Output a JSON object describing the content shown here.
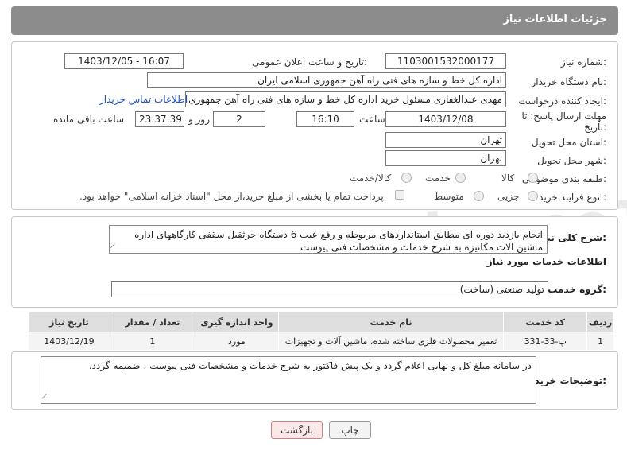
{
  "header": {
    "title": "جزئیات اطلاعات نیاز"
  },
  "form": {
    "need_number_label": "شماره نیاز:",
    "need_number": "1103001532000177",
    "announce_label": "تاریخ و ساعت اعلان عمومی:",
    "announce_value": "1403/12/05 - 16:07",
    "buyer_org_label": "نام دستگاه خریدار:",
    "buyer_org": "اداره کل خط و سازه های فنی راه آهن جمهوری اسلامی ایران",
    "creator_label": "ایجاد کننده درخواست:",
    "creator": "مهدی عبدالغفاری مسئول خرید اداره کل خط و سازه های فنی راه آهن جمهوری",
    "contact_link": "اطلاعات تماس خریدار",
    "deadline_label_1": "مهلت ارسال پاسخ: تا",
    "deadline_label_2": "تاریخ:",
    "deadline_date": "1403/12/08",
    "time_label": "ساعت",
    "deadline_time": "16:10",
    "days_value": "2",
    "days_label": "روز و",
    "remaining_value": "23:37:39",
    "remaining_label": "ساعت باقی مانده",
    "province_label": "استان محل تحویل:",
    "province": "تهران",
    "city_label": "شهر محل تحویل:",
    "city": "تهران",
    "category_label": "طبقه بندی موضوعی:",
    "category_options": [
      "کالا",
      "خدمت",
      "کالا/خدمت"
    ],
    "process_label": "نوع فرآیند خرید :",
    "process_options": [
      "جزیی",
      "متوسط"
    ],
    "payment_note": "پرداخت تمام یا بخشی از مبلغ خرید،از محل \"اسناد خزانه اسلامی\" خواهد بود."
  },
  "description": {
    "label": "شرح کلی نیاز:",
    "text": "انجام بازدید دوره ای مطابق استانداردهای مربوطه و رفع عیب 6 دستگاه جرثقیل سقفی کارگاههای اداره ماشین آلات مکانیزه به شرح خدمات و مشخصات فنی پیوست"
  },
  "services": {
    "section_title": "اطلاعات خدمات مورد نیاز",
    "group_label": "گروه خدمت:",
    "group_value": "تولید صنعتی (ساخت)",
    "columns": [
      "ردیف",
      "کد خدمت",
      "نام خدمت",
      "واحد اندازه گیری",
      "تعداد / مقدار",
      "تاریخ نیاز"
    ],
    "rows": [
      [
        "1",
        "پ-33-331",
        "تعمیر محصولات فلزی ساخته شده، ماشین آلات و تجهیزات",
        "مورد",
        "1",
        "1403/12/19"
      ]
    ]
  },
  "buyer_notes": {
    "label": "توضیحات خریدار:",
    "text": "در سامانه مبلغ کل و نهایی اعلام گردد و یک پیش فاکتور به شرح خدمات و مشخصات فنی پیوست ، ضمیمه گردد."
  },
  "buttons": {
    "print": "چاپ",
    "back": "بازگشت"
  },
  "watermark": {
    "text": "AriaTender.neT"
  }
}
